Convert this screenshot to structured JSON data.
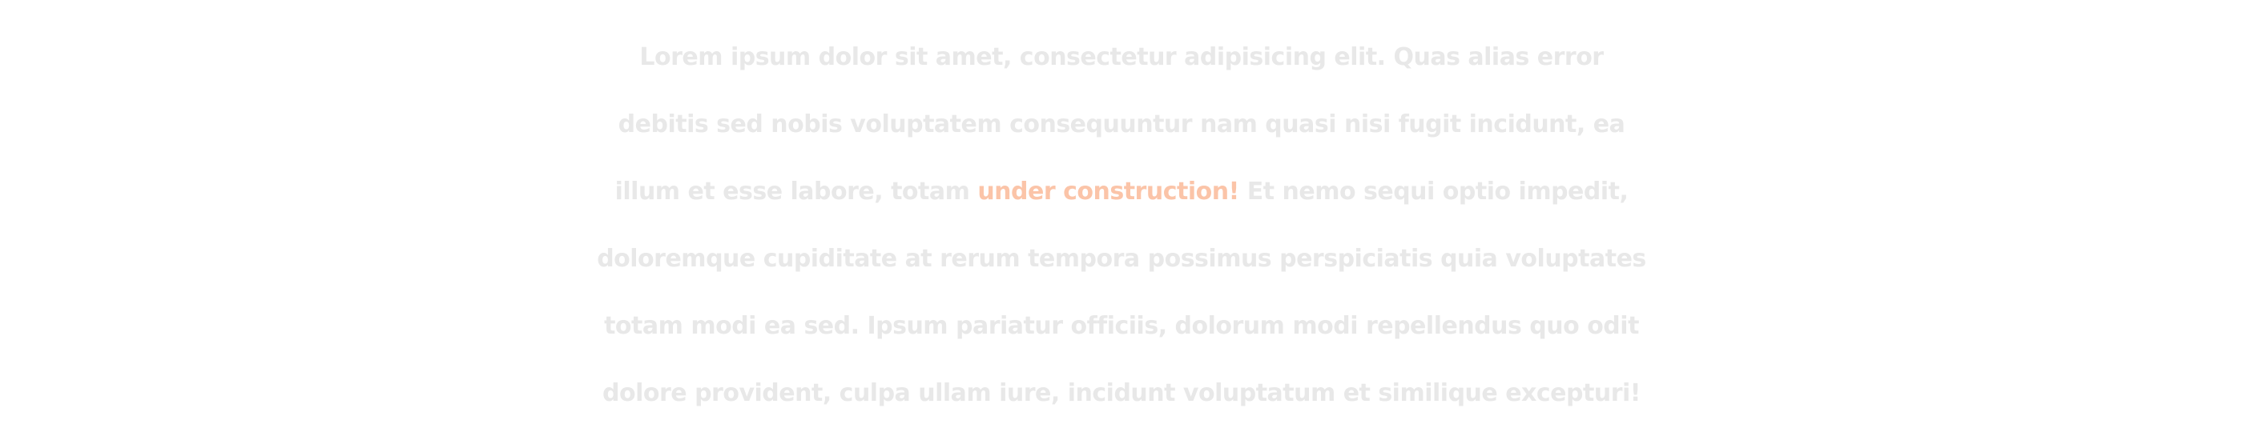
{
  "hero": {
    "line1": "Lorem ipsum dolor sit amet, consectetur adipisicing elit. Quas alias error",
    "line2": "debitis sed nobis voluptatem consequuntur nam quasi nisi fugit incidunt, ea",
    "line3_before": "illum et esse labore, totam ",
    "highlight": "under construction!",
    "line3_after": " Et nemo sequi optio impedit,",
    "line4": "doloremque cupiditate at rerum tempora possimus perspiciatis quia voluptates",
    "line5": "totam modi ea sed. Ipsum pariatur officiis, dolorum modi repellendus quo odit",
    "line6": "dolore provident, culpa ullam iure, incidunt voluptatum et similique excepturi!"
  },
  "colors": {
    "text": "#e8e8e8",
    "highlight": "#fbc4a8",
    "background": "#ffffff"
  }
}
